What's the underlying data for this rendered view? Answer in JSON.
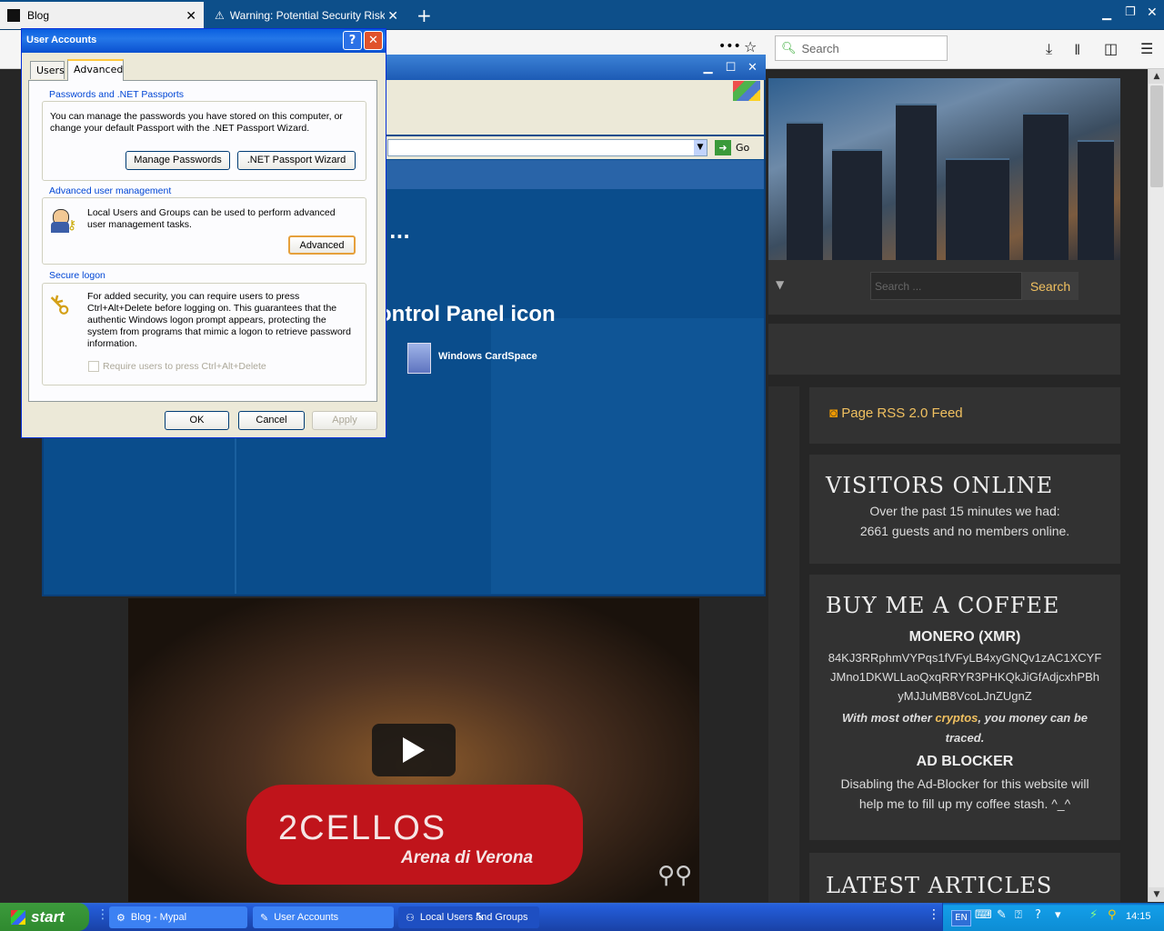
{
  "browser": {
    "tabs": [
      {
        "label": "Blog",
        "active": true
      },
      {
        "label": "Warning: Potential Security Risk A",
        "active": false
      }
    ],
    "search_placeholder": "Search",
    "new_tab": "+"
  },
  "page": {
    "site_search_placeholder": "Search ...",
    "site_search_button": "Search",
    "rss": "Page RSS 2.0 Feed",
    "visitors": {
      "title": "VISITORS ONLINE",
      "line1": "Over the past 15 minutes we had:",
      "line2": "2661 guests and no members online."
    },
    "coffee": {
      "title": "BUY ME A COFFEE",
      "monero": "MONERO (XMR)",
      "addr1": "84KJ3RRphmVYPqs1fVFyLB4xyGNQv1zAC1XCYF",
      "addr2": "JMno1DKWLLaoQxqRRYR3PHKQkJiGfAdjcxhPBh",
      "addr3": "yMJJuMB8VcoLJnZUgnZ",
      "note_a": "With most other ",
      "note_b": "cryptos",
      "note_c": ", you money can be traced.",
      "adblock": "AD BLOCKER",
      "adblock_text": "Disabling the Ad-Blocker for this website will help me to fill up my coffee stash. ^_^"
    },
    "latest": "LATEST ARTICLES",
    "video_title": "2CELLOS",
    "video_subtitle": "Arena di Verona"
  },
  "control_panel": {
    "heading": "ontrol Panel icon",
    "ellipsis": "...",
    "item": "Windows CardSpace",
    "go": "Go"
  },
  "dialog": {
    "title": "User Accounts",
    "tabs": [
      "Users",
      "Advanced"
    ],
    "group1": {
      "label": "Passwords and .NET Passports",
      "text": "You can manage the passwords you have stored on this computer, or change your default Passport with the .NET Passport Wizard.",
      "btn1": "Manage Passwords",
      "btn2": ".NET Passport Wizard"
    },
    "group2": {
      "label": "Advanced user management",
      "text": "Local Users and Groups can be used to perform advanced user management tasks.",
      "btn": "Advanced"
    },
    "group3": {
      "label": "Secure logon",
      "text": "For added security, you can require users to press Ctrl+Alt+Delete before logging on. This guarantees that the authentic Windows logon prompt appears, protecting the system from programs that mimic a logon to retrieve password information.",
      "checkbox": "Require users to press Ctrl+Alt+Delete"
    },
    "ok": "OK",
    "cancel": "Cancel",
    "apply": "Apply"
  },
  "taskbar": {
    "start": "start",
    "tasks": [
      "Blog - Mypal",
      "User Accounts",
      "Local Users and Groups"
    ],
    "lang": "EN",
    "clock": "14:15"
  }
}
